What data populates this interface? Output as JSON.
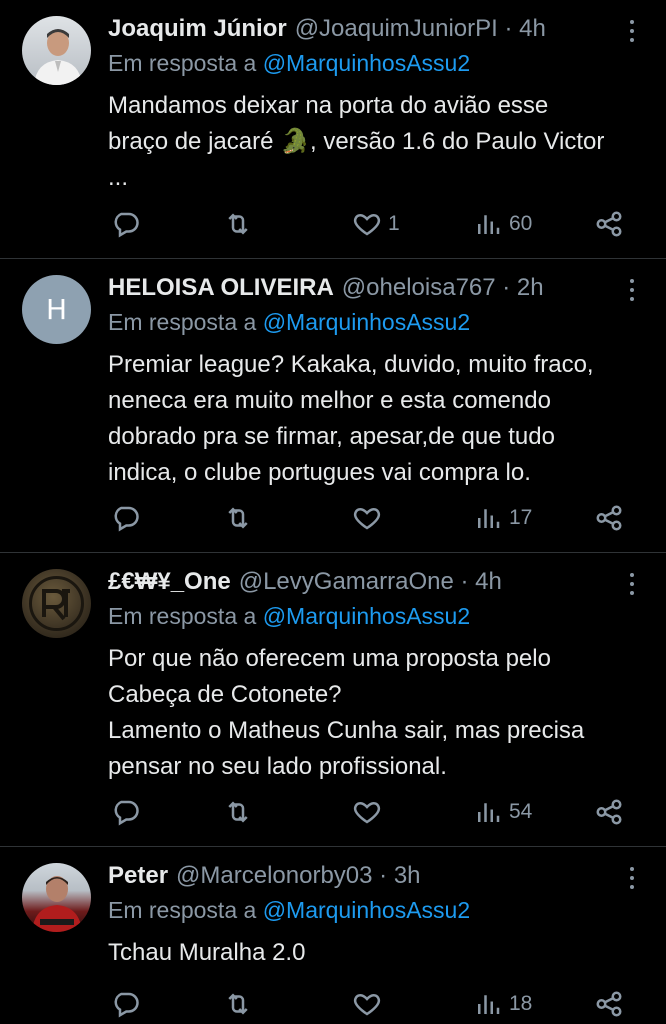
{
  "tweets": [
    {
      "name": "Joaquim Júnior",
      "handle": "@JoaquimJuniorPI · 4h",
      "reply_prefix": "Em resposta a",
      "mention": "@MarquinhosAssu2",
      "body": "Mandamos deixar na porta do avião esse\nbraço de jacaré 🐊, versão 1.6 do Paulo Victor\n...",
      "replies": "",
      "retweets": "",
      "likes": "1",
      "views": "60"
    },
    {
      "name": "HELOISA OLIVEIRA",
      "handle": "@oheloisa767 · 2h",
      "avatar_letter": "H",
      "reply_prefix": "Em resposta a",
      "mention": "@MarquinhosAssu2",
      "body": "Premiar league? Kakaka, duvido, muito fraco,\nneneca era muito melhor e esta comendo\ndobrado pra se firmar, apesar,de que tudo\nindica, o clube portugues vai compra lo.",
      "replies": "",
      "retweets": "",
      "likes": "",
      "views": "17"
    },
    {
      "name": "£€₩¥_One",
      "handle": "@LevyGamarraOne · 4h",
      "reply_prefix": "Em resposta a",
      "mention": "@MarquinhosAssu2",
      "body": "Por que não oferecem uma proposta pelo\nCabeça de Cotonete?\nLamento o Matheus Cunha sair, mas precisa\npensar no seu lado profissional.",
      "replies": "",
      "retweets": "",
      "likes": "",
      "views": "54"
    },
    {
      "name": "Peter",
      "handle": "@Marcelonorby03 · 3h",
      "reply_prefix": "Em resposta a",
      "mention": "@MarquinhosAssu2",
      "body": "Tchau Muralha 2.0",
      "replies": "",
      "retweets": "",
      "likes": "",
      "views": "18"
    }
  ],
  "icons": {
    "reply": "reply-icon",
    "retweet": "retweet-icon",
    "like": "heart-icon",
    "views": "views-icon",
    "share": "share-icon",
    "more": "more-icon"
  },
  "colors": {
    "background": "#000000",
    "text": "#e7e9ea",
    "muted": "#8b98a5",
    "link": "#1d9bf0",
    "divider": "#2f3336"
  }
}
